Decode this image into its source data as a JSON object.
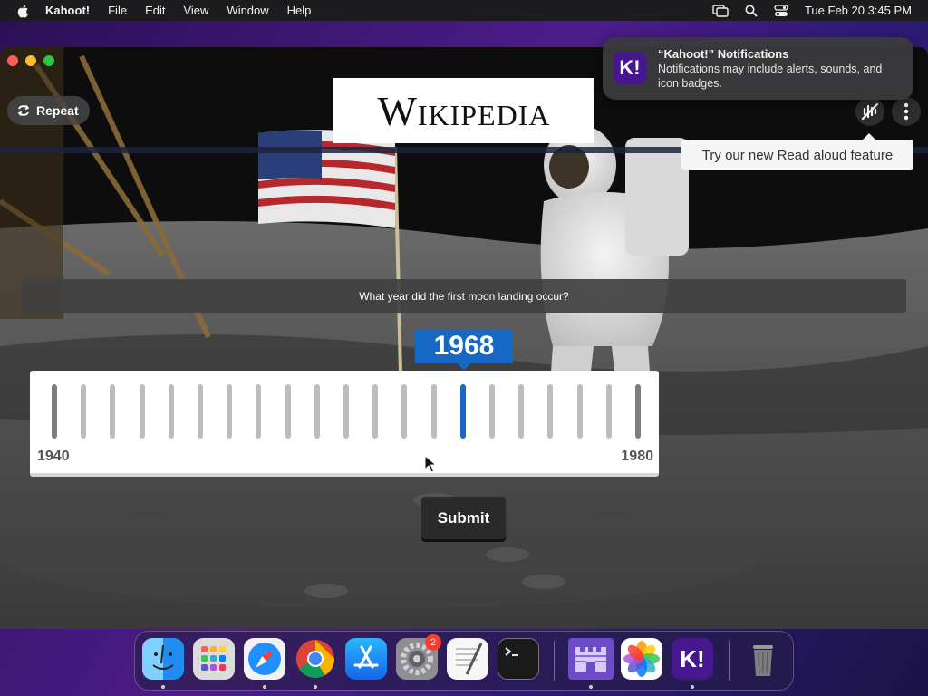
{
  "menubar": {
    "app_name": "Kahoot!",
    "items": [
      "File",
      "Edit",
      "View",
      "Window",
      "Help"
    ],
    "datetime": "Tue Feb 20  3:45 PM"
  },
  "quiz": {
    "repeat_label": "Repeat",
    "logo_text": "Wikipedia",
    "tooltip": "Try our new Read aloud feature",
    "question": "What year did the first moon landing occur?",
    "slider": {
      "min_label": "1940",
      "max_label": "1980",
      "min": 1940,
      "max": 1980,
      "selected_label": "1968",
      "selected": 1968
    },
    "submit_label": "Submit"
  },
  "notification": {
    "title": "“Kahoot!” Notifications",
    "body": "Notifications may include alerts, sounds, and icon badges.",
    "icon_text": "K!"
  },
  "dock": {
    "apps": [
      {
        "name": "finder-icon",
        "running": true
      },
      {
        "name": "launchpad-icon",
        "running": false
      },
      {
        "name": "safari-icon",
        "running": true
      },
      {
        "name": "chrome-icon",
        "running": true
      },
      {
        "name": "app-store-icon",
        "running": false
      },
      {
        "name": "system-settings-icon",
        "running": false,
        "badge": "2"
      },
      {
        "name": "textedit-icon",
        "running": false
      },
      {
        "name": "terminal-icon",
        "running": false
      },
      {
        "name": "castle-app-icon",
        "running": true
      },
      {
        "name": "photos-icon",
        "running": false
      },
      {
        "name": "kahoot-icon",
        "running": true
      },
      {
        "name": "trash-icon",
        "running": false
      }
    ],
    "kahoot_icon_text": "K!"
  },
  "colors": {
    "accent": "#1668c4",
    "kahoot_purple": "#46178f"
  }
}
